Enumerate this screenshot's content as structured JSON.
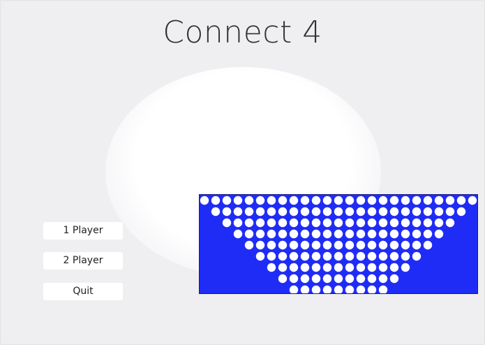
{
  "window": {
    "title": "Connect 4"
  },
  "menu": {
    "buttons": [
      {
        "label": "1 Player"
      },
      {
        "label": "2 Player"
      },
      {
        "label": "Quit"
      }
    ]
  },
  "board": {
    "color": "#1f2cf5",
    "hole_color": "#ffffff",
    "rows": [
      25,
      23,
      21,
      19,
      17,
      15,
      13,
      11,
      9
    ]
  }
}
